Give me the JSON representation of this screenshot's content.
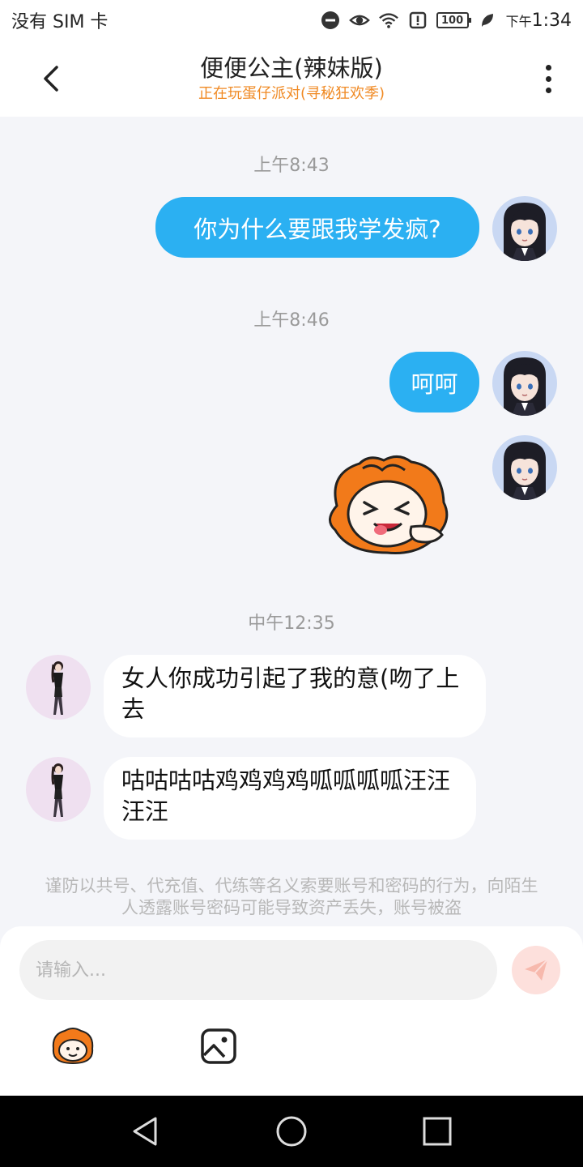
{
  "status_bar": {
    "carrier": "没有 SIM 卡",
    "battery": "100",
    "time_prefix": "下午",
    "time": "1:34"
  },
  "header": {
    "title": "便便公主(辣妹版)",
    "subtitle": "正在玩蛋仔派对(寻秘狂欢季)",
    "back_icon": "chevron-left-icon",
    "more_icon": "more-vertical-icon"
  },
  "messages": {
    "t1": "上午8:43",
    "m1": "你为什么要跟我学发疯?",
    "t2": "上午8:46",
    "m2": "呵呵",
    "t3": "中午12:35",
    "m4": "女人你成功引起了我的意(吻了上去",
    "m5": "咕咕咕咕鸡鸡鸡鸡呱呱呱呱汪汪汪汪"
  },
  "warning": "谨防以共号、代充值、代练等名义索要账号和密码的行为，向陌生人透露账号密码可能导致资产丢失，账号被盗",
  "input": {
    "placeholder": "请输入..."
  },
  "colors": {
    "accent": "#2bb0f2",
    "subtitle": "#f08a24",
    "send_bg": "#fde0dc"
  }
}
